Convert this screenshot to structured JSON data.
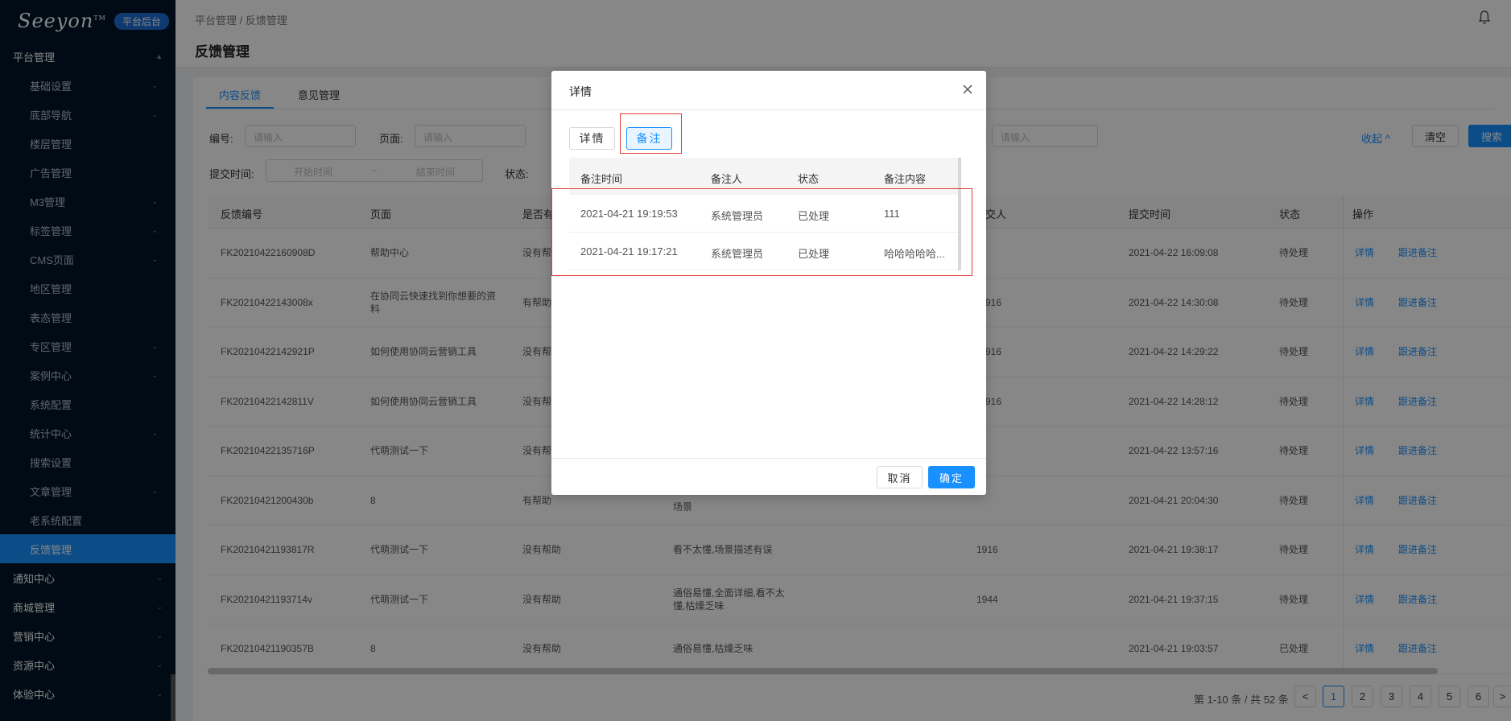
{
  "sidebar": {
    "logo": "Seeyon",
    "logo_tm": "TM",
    "badge": "平台后台",
    "top_items": [
      {
        "label": "平台管理"
      },
      {
        "label": "通知中心"
      },
      {
        "label": "商城管理"
      },
      {
        "label": "营销中心"
      },
      {
        "label": "资源中心"
      },
      {
        "label": "体验中心"
      }
    ],
    "sub_items": [
      {
        "label": "基础设置"
      },
      {
        "label": "底部导航"
      },
      {
        "label": "楼层管理"
      },
      {
        "label": "广告管理"
      },
      {
        "label": "M3管理"
      },
      {
        "label": "标签管理"
      },
      {
        "label": "CMS页面"
      },
      {
        "label": "地区管理"
      },
      {
        "label": "表态管理"
      },
      {
        "label": "专区管理"
      },
      {
        "label": "案例中心"
      },
      {
        "label": "系统配置"
      },
      {
        "label": "统计中心"
      },
      {
        "label": "搜索设置"
      },
      {
        "label": "文章管理"
      },
      {
        "label": "老系统配置"
      },
      {
        "label": "反馈管理"
      }
    ]
  },
  "header": {
    "breadcrumb": "平台管理 / 反馈管理",
    "title": "反馈管理"
  },
  "tabs": [
    {
      "label": "内容反馈"
    },
    {
      "label": "意见管理"
    }
  ],
  "filters": {
    "code_label": "编号:",
    "code_placeholder": "请输入",
    "page_label": "页面:",
    "page_placeholder": "请输入",
    "extra_placeholder": "请输入",
    "time_label": "提交时间:",
    "start_placeholder": "开始时间",
    "tilde": "~",
    "end_placeholder": "结束时间",
    "status_label": "状态:",
    "collapse": "收起 ^",
    "clear": "清空",
    "search": "搜索"
  },
  "table": {
    "headers": [
      "反馈编号",
      "页面",
      "是否有",
      "交人",
      "提交时间",
      "状态",
      "操作"
    ],
    "op_detail": "详情",
    "op_note": "跟进备注",
    "rows": [
      {
        "id": "FK20210422160908D",
        "page": "帮助中心",
        "helpful": "没有帮",
        "reason": "",
        "user": "",
        "time": "2021-04-22 16:09:08",
        "status": "待处理"
      },
      {
        "id": "FK20210422143008x",
        "page": "在协同云快速找到你想要的资料",
        "helpful": "有帮助",
        "reason": "",
        "user": "916",
        "time": "2021-04-22 14:30:08",
        "status": "待处理"
      },
      {
        "id": "FK20210422142921P",
        "page": "如何使用协同云营销工具",
        "helpful": "没有帮",
        "reason": "",
        "user": "916",
        "time": "2021-04-22 14:29:22",
        "status": "待处理"
      },
      {
        "id": "FK20210422142811V",
        "page": "如何使用协同云营销工具",
        "helpful": "没有帮",
        "reason": "",
        "user": "916",
        "time": "2021-04-22 14:28:12",
        "status": "待处理"
      },
      {
        "id": "FK20210422135716P",
        "page": "代萌测试一下",
        "helpful": "没有帮",
        "reason": "",
        "user": "",
        "time": "2021-04-22 13:57:16",
        "status": "待处理"
      },
      {
        "id": "FK20210421200430b",
        "page": "8",
        "helpful": "有帮助",
        "reason": "场景",
        "user": "",
        "time": "2021-04-21 20:04:30",
        "status": "待处理"
      },
      {
        "id": "FK20210421193817R",
        "page": "代萌测试一下",
        "helpful": "没有帮助",
        "reason": "看不太懂,场景描述有误",
        "user": "1916",
        "time": "2021-04-21 19:38:17",
        "status": "待处理"
      },
      {
        "id": "FK20210421193714v",
        "page": "代萌测试一下",
        "helpful": "没有帮助",
        "reason": "通俗易懂,全面详细,看不太懂,枯燥乏味",
        "user": "1944",
        "time": "2021-04-21 19:37:15",
        "status": "待处理"
      },
      {
        "id": "FK20210421190357B",
        "page": "8",
        "helpful": "没有帮助",
        "reason": "通俗易懂,枯燥乏味",
        "user": "",
        "time": "2021-04-21 19:03:57",
        "status": "已处理"
      }
    ]
  },
  "pagination": {
    "info": "第 1-10 条 / 共 52 条",
    "prev": "<",
    "next": ">",
    "pages": [
      "1",
      "2",
      "3",
      "4",
      "5",
      "6"
    ]
  },
  "modal": {
    "title": "详情",
    "tab_detail": "详情",
    "tab_note": "备注",
    "headers": [
      "备注时间",
      "备注人",
      "状态",
      "备注内容"
    ],
    "rows": [
      {
        "time": "2021-04-21 19:19:53",
        "person": "系统管理员",
        "status": "已处理",
        "content": "111"
      },
      {
        "time": "2021-04-21 19:17:21",
        "person": "系统管理员",
        "status": "已处理",
        "content": "哈哈哈哈哈..."
      }
    ],
    "cancel": "取消",
    "ok": "确定"
  }
}
